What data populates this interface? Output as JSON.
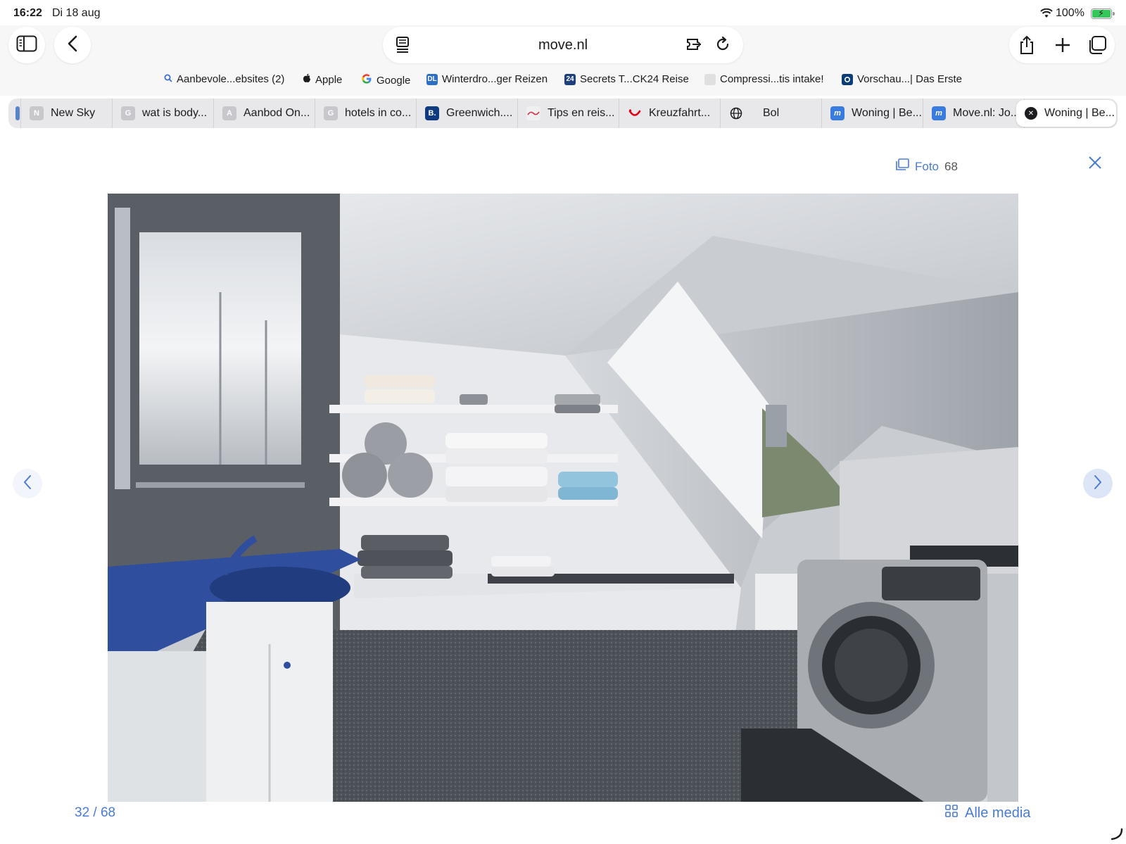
{
  "status_bar": {
    "time": "16:22",
    "date": "Di 18 aug",
    "battery": "100%"
  },
  "toolbar": {
    "url": "move.nl"
  },
  "favorites": [
    {
      "label": "Aanbevole...ebsites (2)",
      "icon": "magnifier-icon"
    },
    {
      "label": "Apple",
      "icon": "apple-logo-icon"
    },
    {
      "label": "Google",
      "icon": "google-logo-icon"
    },
    {
      "label": "Winterdro...ger Reizen",
      "icon": "dl-logo-icon",
      "badge": "DL"
    },
    {
      "label": "Secrets T...CK24 Reise",
      "icon": "ck24-logo-icon",
      "badge": "24"
    },
    {
      "label": "Compressi...tis intake!",
      "icon": "site-icon"
    },
    {
      "label": "Vorschau...| Das Erste",
      "icon": "das-erste-icon"
    }
  ],
  "tabs": [
    {
      "label": "",
      "badge": ""
    },
    {
      "label": "New Sky",
      "badge": "N"
    },
    {
      "label": "wat is body...",
      "badge": "G"
    },
    {
      "label": "Aanbod On...",
      "badge": "A"
    },
    {
      "label": "hotels in co...",
      "badge": "G"
    },
    {
      "label": "Greenwich....",
      "badge": "B."
    },
    {
      "label": "Tips en reis...",
      "badge": ""
    },
    {
      "label": "Kreuzfahrt...",
      "badge": ""
    },
    {
      "label": "Bol",
      "badge": ""
    },
    {
      "label": "Woning | Be...",
      "badge": "m"
    },
    {
      "label": "Move.nl: Jo...",
      "badge": "m"
    },
    {
      "label": "Woning | Be...",
      "badge": "✕"
    }
  ],
  "gallery": {
    "foto_label": "Foto",
    "foto_count": "68",
    "pager": "32 / 68",
    "all_media": "Alle media"
  },
  "colors": {
    "accent": "#4a7bd6",
    "sink_blue": "#2f4f9e"
  }
}
